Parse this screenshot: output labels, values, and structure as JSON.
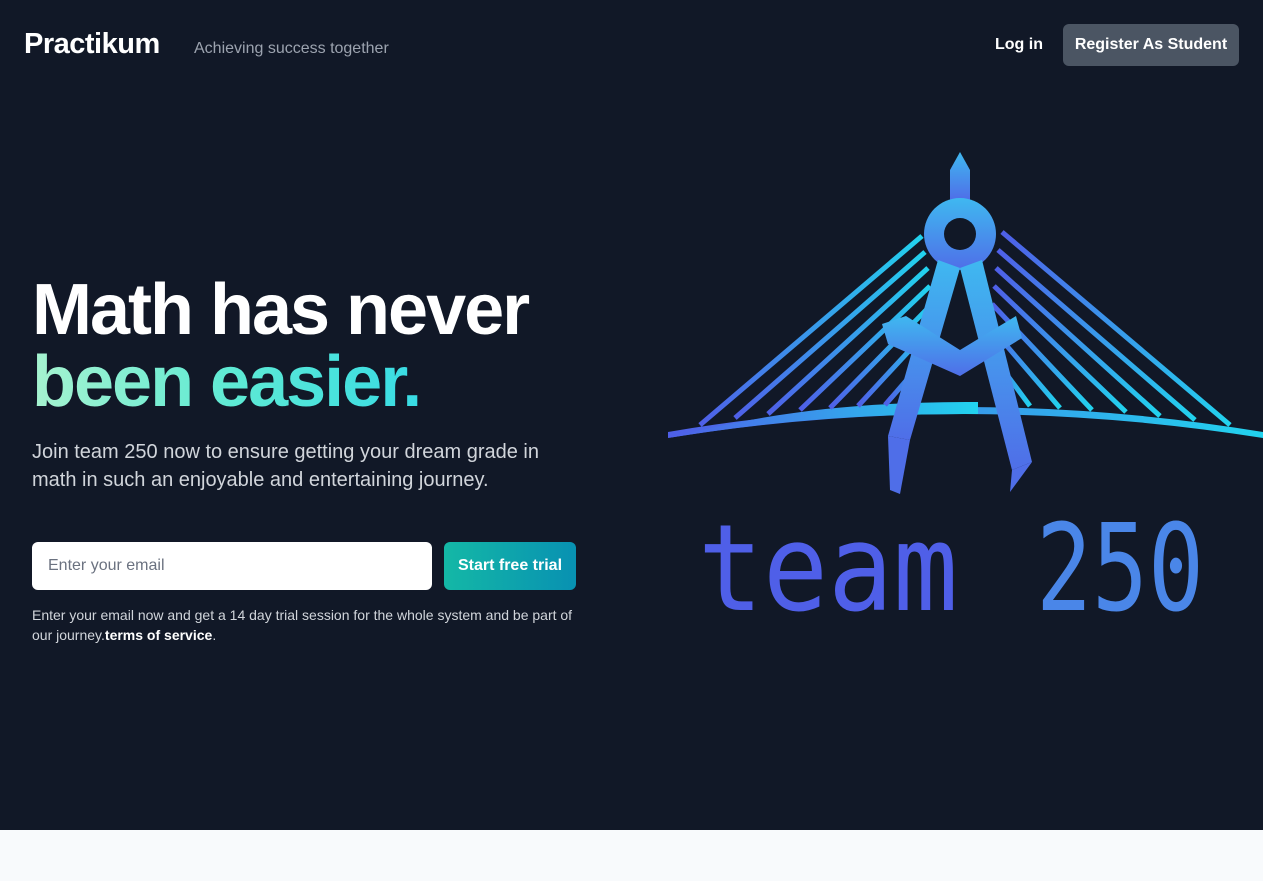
{
  "nav": {
    "brand": "Practikum",
    "tagline": "Achieving success together",
    "login_label": "Log in",
    "register_label": "Register As Student"
  },
  "hero": {
    "headline_line1": "Math has never",
    "headline_line2": "been easier.",
    "subtext": "Join team 250 now to ensure getting your dream grade in math in such an enjoyable and entertaining journey.",
    "email_placeholder": "Enter your email",
    "email_value": "",
    "cta_label": "Start free trial",
    "fineprint_text": "Enter your email now and get a 14 day trial session for the whole system and be part of our journey.",
    "fineprint_link": "terms of service",
    "fineprint_end": "."
  },
  "logo": {
    "icon": "compass-bridge-icon",
    "text_word": "team",
    "text_number": "250"
  },
  "colors": {
    "background": "#111827",
    "accent_start": "#14b8a6",
    "accent_end": "#0891b2",
    "logo_blue": "#4f6ee8",
    "logo_cyan": "#22d3ee"
  }
}
